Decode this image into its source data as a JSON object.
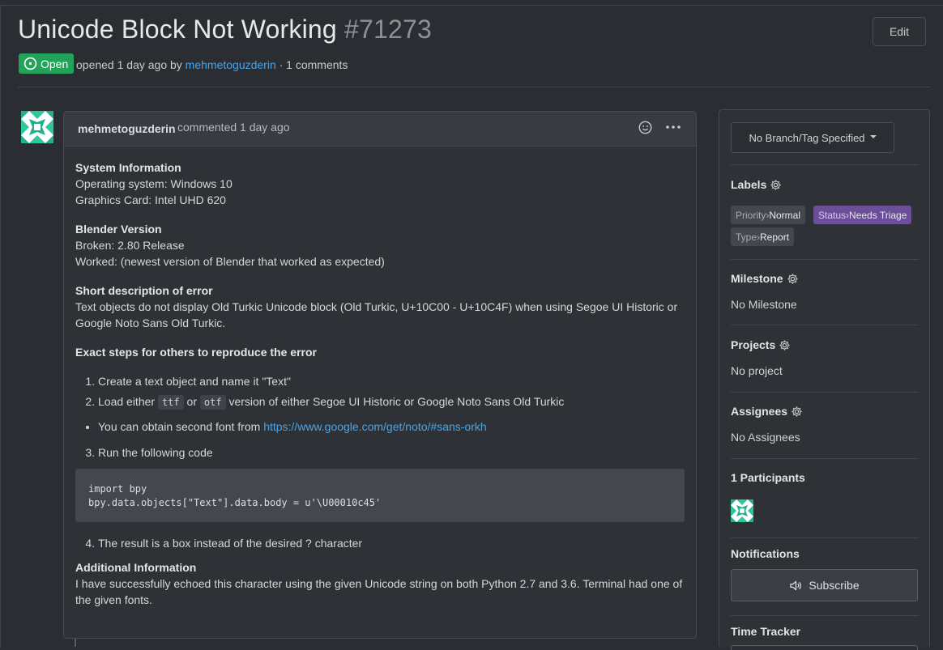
{
  "issue": {
    "title": "Unicode Block Not Working",
    "number": "#71273",
    "status": "Open",
    "opened_text": "opened 1 day ago by",
    "author": "mehmetoguzderin",
    "comments_text": "· 1 comments",
    "edit_label": "Edit"
  },
  "comment": {
    "author": "mehmetoguzderin",
    "when": "commented 1 day ago",
    "sys_heading": "System Information",
    "sys_os": "Operating system: Windows 10",
    "sys_gpu": "Graphics Card: Intel UHD 620",
    "ver_heading": "Blender Version",
    "ver_broken": "Broken: 2.80 Release",
    "ver_worked": "Worked: (newest version of Blender that worked as expected)",
    "desc_heading": "Short description of error",
    "desc_text": "Text objects do not display Old Turkic Unicode block (Old Turkic, U+10C00 - U+10C4F) when using Segoe UI Historic or Google Noto Sans Old Turkic.",
    "steps_heading": "Exact steps for others to reproduce the error",
    "step1": "Create a text object and name it \"Text\"",
    "step2_a": "Load either",
    "step2_code1": "ttf",
    "step2_b": "or",
    "step2_code2": "otf",
    "step2_c": "version of either Segoe UI Historic or Google Noto Sans Old Turkic",
    "bullet_text": "You can obtain second font from",
    "bullet_link": "https://www.google.com/get/noto/#sans-orkh",
    "step3": "Run the following code",
    "code": "import bpy\nbpy.data.objects[\"Text\"].data.body = u'\\U00010c45'",
    "step4": "The result is a box instead of the desired ? character",
    "add_heading": "Additional Information",
    "add_text": "I have successfully echoed this character using the given Unicode string on both Python 2.7 and 3.6. Terminal had one of the given fonts."
  },
  "sidebar": {
    "branch_label": "No Branch/Tag Specified",
    "labels_title": "Labels",
    "labels": [
      {
        "key": "Priority",
        "sep": " › ",
        "value": "Normal",
        "color": "#44484e"
      },
      {
        "key": "Status",
        "sep": " › ",
        "value": "Needs Triage",
        "color": "#6b4f99"
      },
      {
        "key": "Type",
        "sep": " › ",
        "value": "Report",
        "color": "#44484e"
      }
    ],
    "milestone_title": "Milestone",
    "milestone_value": "No Milestone",
    "projects_title": "Projects",
    "projects_value": "No project",
    "assignees_title": "Assignees",
    "assignees_value": "No Assignees",
    "participants_title": "1 Participants",
    "notifications_title": "Notifications",
    "subscribe_label": "Subscribe",
    "tracker_title": "Time Tracker"
  },
  "colors": {
    "open_badge": "#21a35a",
    "link": "#4aa5e8",
    "background": "#2a2d31"
  }
}
